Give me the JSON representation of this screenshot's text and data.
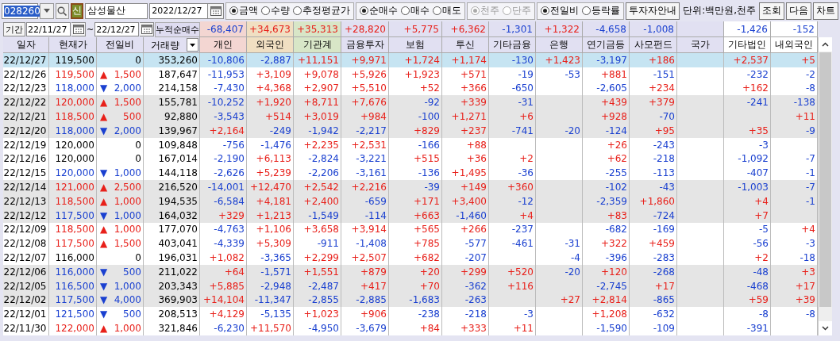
{
  "toolbar": {
    "code": {
      "value": "028260",
      "text_selected": true
    },
    "badge": "신",
    "name": "삼성물산",
    "date": "2022/12/27",
    "radio_groups": [
      {
        "disabled": false,
        "options": [
          {
            "label": "금액",
            "selected": true
          },
          {
            "label": "수량",
            "selected": false
          },
          {
            "label": "추정평균가",
            "selected": false
          }
        ]
      },
      {
        "disabled": false,
        "options": [
          {
            "label": "순매수",
            "selected": true
          },
          {
            "label": "매수",
            "selected": false
          },
          {
            "label": "매도",
            "selected": false
          }
        ]
      },
      {
        "disabled": true,
        "options": [
          {
            "label": "천주",
            "selected": true
          },
          {
            "label": "단주",
            "selected": false
          }
        ]
      },
      {
        "disabled": false,
        "options": [
          {
            "label": "전일비",
            "selected": true
          },
          {
            "label": "등락률",
            "selected": false
          }
        ]
      }
    ],
    "guide_button": "투자자안내",
    "unit": "단위:백만원,천주",
    "buttons": [
      "조회",
      "다음",
      "차트"
    ]
  },
  "period": {
    "label": "기간",
    "from": "22/11/27",
    "separator": "~",
    "to": "22/12/27",
    "summary_label": "누적순매수",
    "totals": {
      "individual": "-68,407",
      "foreign": "+34,673",
      "institutions": "+35,313",
      "financial_investment": "+28,820",
      "insurance": "+5,775",
      "trust": "+6,362",
      "other_finance": "-1,301",
      "bank": "+1,322",
      "pension": "-4,658",
      "private_fund": "-1,008",
      "other_corp": "-1,426",
      "domestic_foreign": "-152"
    }
  },
  "table": {
    "columns": [
      "일자",
      "현재가",
      "전일비",
      "거래량",
      "개인",
      "외국인",
      "기관계",
      "금융투자",
      "보험",
      "투신",
      "기타금융",
      "은행",
      "연기금등",
      "사모펀드",
      "국가",
      "기타법인",
      "내외국인"
    ],
    "rows": [
      {
        "selected": true,
        "date": "22/12/27",
        "price": "119,500",
        "up": false,
        "down": false,
        "change": "0",
        "volume": "353,260",
        "investors": {
          "individual": "-10,806",
          "foreign": "-2,887",
          "institutions": "+11,151",
          "financial_investment": "+9,971",
          "insurance": "+1,724",
          "trust": "+1,174",
          "other_finance": "-130",
          "bank": "+1,423",
          "pension": "-3,197",
          "private_fund": "+186",
          "other_corp": "+2,537",
          "domestic_foreign": "+5"
        }
      },
      {
        "selected": false,
        "date": "22/12/26",
        "price": "119,500",
        "up": true,
        "down": false,
        "arrow": "▲",
        "change": "1,500",
        "volume": "187,647",
        "investors": {
          "individual": "-11,953",
          "foreign": "+3,109",
          "institutions": "+9,078",
          "financial_investment": "+5,926",
          "insurance": "+1,923",
          "trust": "+571",
          "other_finance": "-19",
          "bank": "-53",
          "pension": "+881",
          "private_fund": "-151",
          "other_corp": "-232",
          "domestic_foreign": "-2"
        }
      },
      {
        "selected": false,
        "date": "22/12/23",
        "price": "118,000",
        "up": false,
        "down": true,
        "arrow": "▼",
        "change": "2,000",
        "volume": "214,158",
        "investors": {
          "individual": "-7,430",
          "foreign": "+4,368",
          "institutions": "+2,907",
          "financial_investment": "+5,510",
          "insurance": "+52",
          "trust": "+366",
          "other_finance": "-650",
          "pension": "-2,605",
          "private_fund": "+234",
          "other_corp": "+162",
          "domestic_foreign": "-8"
        }
      },
      {
        "selected": false,
        "date": "22/12/22",
        "price": "120,000",
        "up": true,
        "down": false,
        "arrow": "▲",
        "change": "1,500",
        "volume": "155,781",
        "investors": {
          "individual": "-10,252",
          "foreign": "+1,920",
          "institutions": "+8,711",
          "financial_investment": "+7,676",
          "insurance": "-92",
          "trust": "+339",
          "other_finance": "-31",
          "pension": "+439",
          "private_fund": "+379",
          "other_corp": "-241",
          "domestic_foreign": "-138"
        }
      },
      {
        "selected": false,
        "date": "22/12/21",
        "price": "118,500",
        "up": true,
        "down": false,
        "arrow": "▲",
        "change": "500",
        "volume": "92,880",
        "investors": {
          "individual": "-3,543",
          "foreign": "+514",
          "institutions": "+3,019",
          "financial_investment": "+984",
          "insurance": "-100",
          "trust": "+1,271",
          "other_finance": "+6",
          "pension": "+928",
          "private_fund": "-70",
          "domestic_foreign": "+11"
        }
      },
      {
        "selected": false,
        "date": "22/12/20",
        "price": "118,000",
        "up": false,
        "down": true,
        "arrow": "▼",
        "change": "2,000",
        "volume": "139,967",
        "investors": {
          "individual": "+2,164",
          "foreign": "-249",
          "institutions": "-1,942",
          "financial_investment": "-2,217",
          "insurance": "+829",
          "trust": "+237",
          "other_finance": "-741",
          "bank": "-20",
          "pension": "-124",
          "private_fund": "+95",
          "other_corp": "+35",
          "domestic_foreign": "-9"
        }
      },
      {
        "selected": false,
        "date": "22/12/19",
        "price": "120,000",
        "up": false,
        "down": false,
        "change": "0",
        "volume": "109,848",
        "investors": {
          "individual": "-756",
          "foreign": "-1,476",
          "institutions": "+2,235",
          "financial_investment": "+2,531",
          "insurance": "-166",
          "trust": "+88",
          "pension": "+26",
          "private_fund": "-243",
          "other_corp": "-3"
        }
      },
      {
        "selected": false,
        "date": "22/12/16",
        "price": "120,000",
        "up": false,
        "down": false,
        "change": "0",
        "volume": "167,014",
        "investors": {
          "individual": "-2,190",
          "foreign": "+6,113",
          "institutions": "-2,824",
          "financial_investment": "-3,221",
          "insurance": "+515",
          "trust": "+36",
          "other_finance": "+2",
          "pension": "+62",
          "private_fund": "-218",
          "other_corp": "-1,092",
          "domestic_foreign": "-7"
        }
      },
      {
        "selected": false,
        "date": "22/12/15",
        "price": "120,000",
        "up": false,
        "down": true,
        "arrow": "▼",
        "change": "1,000",
        "volume": "144,118",
        "investors": {
          "individual": "-2,626",
          "foreign": "+5,239",
          "institutions": "-2,206",
          "financial_investment": "-3,161",
          "insurance": "-136",
          "trust": "+1,495",
          "other_finance": "-36",
          "pension": "-255",
          "private_fund": "-113",
          "other_corp": "-407",
          "domestic_foreign": "-1"
        }
      },
      {
        "selected": false,
        "date": "22/12/14",
        "price": "121,000",
        "up": true,
        "down": false,
        "arrow": "▲",
        "change": "2,500",
        "volume": "216,520",
        "investors": {
          "individual": "-14,001",
          "foreign": "+12,470",
          "institutions": "+2,542",
          "financial_investment": "+2,216",
          "insurance": "-39",
          "trust": "+149",
          "other_finance": "+360",
          "pension": "-102",
          "private_fund": "-43",
          "other_corp": "-1,003",
          "domestic_foreign": "-7"
        }
      },
      {
        "selected": false,
        "date": "22/12/13",
        "price": "118,500",
        "up": true,
        "down": false,
        "arrow": "▲",
        "change": "1,000",
        "volume": "194,535",
        "investors": {
          "individual": "-6,584",
          "foreign": "+4,181",
          "institutions": "+2,400",
          "financial_investment": "-659",
          "insurance": "+171",
          "trust": "+3,400",
          "other_finance": "-12",
          "pension": "-2,359",
          "private_fund": "+1,860",
          "other_corp": "+4",
          "domestic_foreign": "-1"
        }
      },
      {
        "selected": false,
        "date": "22/12/12",
        "price": "117,500",
        "up": false,
        "down": true,
        "arrow": "▼",
        "change": "1,000",
        "volume": "164,032",
        "investors": {
          "individual": "+329",
          "foreign": "+1,213",
          "institutions": "-1,549",
          "financial_investment": "-114",
          "insurance": "+663",
          "trust": "-1,460",
          "other_finance": "+4",
          "pension": "+83",
          "private_fund": "-724",
          "other_corp": "+7"
        }
      },
      {
        "selected": false,
        "date": "22/12/09",
        "price": "118,500",
        "up": true,
        "down": false,
        "arrow": "▲",
        "change": "1,000",
        "volume": "177,070",
        "investors": {
          "individual": "-4,763",
          "foreign": "+1,106",
          "institutions": "+3,658",
          "financial_investment": "+3,914",
          "insurance": "+565",
          "trust": "+266",
          "other_finance": "-237",
          "pension": "-682",
          "private_fund": "-169",
          "other_corp": "-5",
          "domestic_foreign": "+4"
        }
      },
      {
        "selected": false,
        "date": "22/12/08",
        "price": "117,500",
        "up": true,
        "down": false,
        "arrow": "▲",
        "change": "1,500",
        "volume": "403,041",
        "investors": {
          "individual": "-4,339",
          "foreign": "+5,309",
          "institutions": "-911",
          "financial_investment": "-1,408",
          "insurance": "+785",
          "trust": "-577",
          "other_finance": "-461",
          "bank": "-31",
          "pension": "+322",
          "private_fund": "+459",
          "other_corp": "-56",
          "domestic_foreign": "-3"
        }
      },
      {
        "selected": false,
        "date": "22/12/07",
        "price": "116,000",
        "up": false,
        "down": false,
        "change": "0",
        "volume": "196,031",
        "investors": {
          "individual": "+1,082",
          "foreign": "-3,365",
          "institutions": "+2,299",
          "financial_investment": "+2,507",
          "insurance": "+682",
          "trust": "-207",
          "bank": "-4",
          "pension": "-396",
          "private_fund": "-283",
          "other_corp": "+2",
          "domestic_foreign": "-18"
        }
      },
      {
        "selected": false,
        "date": "22/12/06",
        "price": "116,000",
        "up": false,
        "down": true,
        "arrow": "▼",
        "change": "500",
        "volume": "211,022",
        "investors": {
          "individual": "+64",
          "foreign": "-1,571",
          "institutions": "+1,551",
          "financial_investment": "+879",
          "insurance": "+20",
          "trust": "+299",
          "other_finance": "+520",
          "bank": "-20",
          "pension": "+120",
          "private_fund": "-268",
          "other_corp": "-48",
          "domestic_foreign": "+3"
        }
      },
      {
        "selected": false,
        "date": "22/12/05",
        "price": "116,500",
        "up": false,
        "down": true,
        "arrow": "▼",
        "change": "1,000",
        "volume": "203,343",
        "investors": {
          "individual": "+5,885",
          "foreign": "-2,948",
          "institutions": "-2,487",
          "financial_investment": "+417",
          "insurance": "+70",
          "trust": "-362",
          "other_finance": "+116",
          "pension": "-2,745",
          "private_fund": "+17",
          "other_corp": "-468",
          "domestic_foreign": "+17"
        }
      },
      {
        "selected": false,
        "date": "22/12/02",
        "price": "117,500",
        "up": false,
        "down": true,
        "arrow": "▼",
        "change": "4,000",
        "volume": "369,903",
        "investors": {
          "individual": "+14,104",
          "foreign": "-11,347",
          "institutions": "-2,855",
          "financial_investment": "-2,885",
          "insurance": "-1,683",
          "trust": "-263",
          "bank": "+27",
          "pension": "+2,814",
          "private_fund": "-865",
          "other_corp": "+59",
          "domestic_foreign": "+39"
        }
      },
      {
        "selected": false,
        "date": "22/12/01",
        "price": "121,500",
        "up": false,
        "down": true,
        "arrow": "▼",
        "change": "500",
        "volume": "208,513",
        "investors": {
          "individual": "+4,129",
          "foreign": "-5,135",
          "institutions": "+1,023",
          "financial_investment": "+906",
          "insurance": "-238",
          "trust": "-218",
          "other_finance": "-3",
          "pension": "+1,208",
          "private_fund": "-632",
          "other_corp": "-8",
          "domestic_foreign": "-8"
        }
      },
      {
        "selected": false,
        "date": "22/11/30",
        "price": "122,000",
        "up": true,
        "down": false,
        "arrow": "▲",
        "change": "1,000",
        "volume": "321,846",
        "investors": {
          "individual": "-6,230",
          "foreign": "+11,570",
          "institutions": "-4,950",
          "financial_investment": "-3,679",
          "insurance": "+84",
          "trust": "+333",
          "other_finance": "+11",
          "pension": "-1,590",
          "private_fund": "-109",
          "other_corp": "-391"
        }
      }
    ]
  }
}
